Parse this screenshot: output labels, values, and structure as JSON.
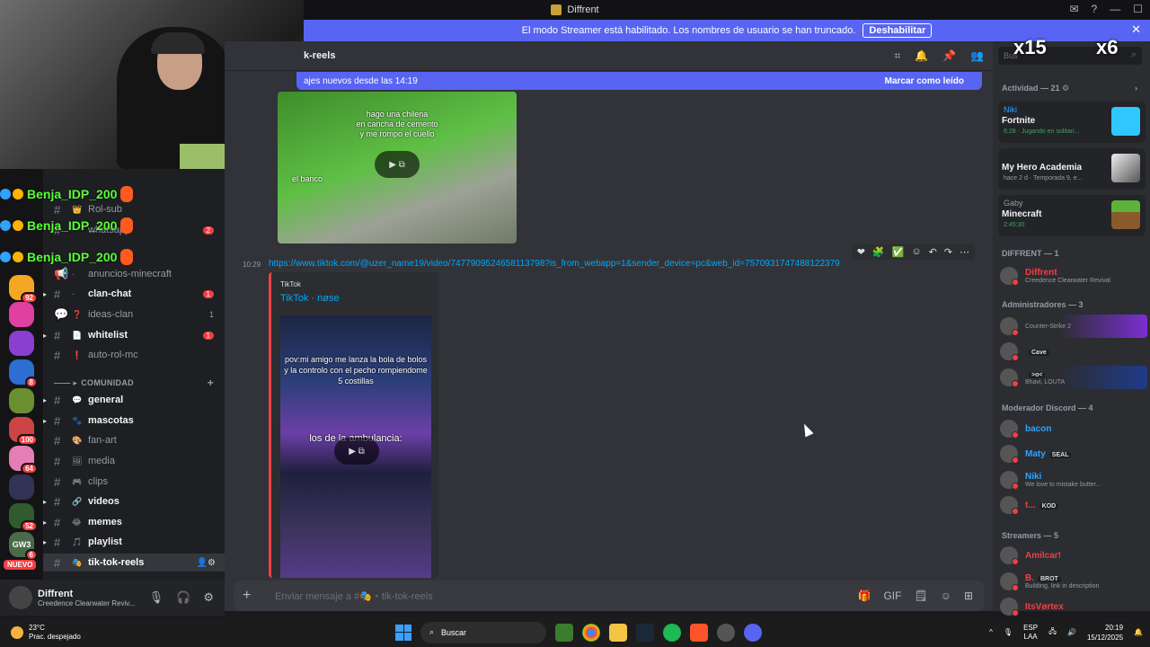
{
  "titlebar": {
    "title": "Diffrent"
  },
  "streamer_bar": {
    "text": "El modo Streamer está habilitado. Los nombres de usuario se han truncado.",
    "button": "Deshabilitar"
  },
  "overlay": {
    "users": [
      "Benja_IDP_200",
      "Benja_IDP_200",
      "Benja_IDP_200"
    ],
    "emotes": [
      "x15",
      "x6"
    ]
  },
  "guilds": [
    {
      "badge": "92"
    },
    {
      "badge": ""
    },
    {
      "badge": ""
    },
    {
      "badge": "8"
    },
    {
      "badge": ""
    },
    {
      "badge": "100"
    },
    {
      "badge": "64"
    },
    {
      "badge": ""
    },
    {
      "badge": "52"
    },
    {
      "badge": "6"
    },
    {
      "label": "NUEVO"
    }
  ],
  "channels": {
    "top": [
      {
        "label": "Rol-sub",
        "badge": ""
      },
      {
        "label": "whatsapp",
        "badge": "2"
      },
      {
        "label": "anuncios-minecraft",
        "badge": ""
      }
    ],
    "list": [
      {
        "label": "clan-chat",
        "badge": "1",
        "bold": true
      },
      {
        "label": "ideas-clan",
        "count": "1",
        "bold": false
      },
      {
        "label": "whitelist",
        "badge": "1",
        "bold": true
      },
      {
        "label": "auto-rol-mc",
        "badge": "",
        "bold": false
      }
    ],
    "category": "COMUNIDAD",
    "community": [
      {
        "label": "general",
        "bold": true
      },
      {
        "label": "mascotas",
        "bold": true
      },
      {
        "label": "fan-art",
        "bold": false
      },
      {
        "label": "media",
        "bold": false
      },
      {
        "label": "clips",
        "bold": false
      },
      {
        "label": "videos",
        "bold": true
      },
      {
        "label": "memes",
        "bold": true
      },
      {
        "label": "playlist",
        "bold": true
      },
      {
        "label": "tik-tok-reels",
        "bold": true,
        "selected": true
      }
    ]
  },
  "user_panel": {
    "name": "Diffrent",
    "status": "Creedence Clearwater Reviv..."
  },
  "header": {
    "channel": "k-reels"
  },
  "new_messages": {
    "text": "ajes nuevos desde las 14:19",
    "action": "Marcar como leído"
  },
  "message1": {
    "captions": [
      "hago una chilena",
      "en cancha de cemento",
      "y me rompo el cuello",
      "el banco"
    ]
  },
  "message2": {
    "time": "10:29",
    "link": "https://www.tiktok.com/@uzer_name19/video/7477909524658113798?is_from_webapp=1&sender_device=pc&web_id=7570931747488122379",
    "embed_provider": "TikTok",
    "embed_title": "TikTok · nøse",
    "captions": [
      "pov:mi amigo me lanza la bola de bolos",
      "y la controlo con el pecho rompiendome",
      "5 costillas",
      "los de la ambulancia:"
    ]
  },
  "composer": {
    "placeholder": "Enviar mensaje a #🎭・tik-tok-reels"
  },
  "members": {
    "search": "Bus",
    "activity_title": "Actividad — 21",
    "activities": [
      {
        "who": "Niki",
        "game": "Fortnite",
        "detail": "6:28 · Jugando en solitari..."
      },
      {
        "who": "",
        "game": "My Hero Academia",
        "detail": "hace 2 d · Temporada 9, e..."
      },
      {
        "who": "Gaby",
        "game": "Minecraft",
        "detail": "2:45:30"
      }
    ],
    "groups": [
      {
        "title": "DIFFRENT — 1",
        "members": [
          {
            "name": "Diffrent",
            "status": "Creedence Clearwater Revival",
            "color": "#f23f43"
          }
        ]
      },
      {
        "title": "Administradores — 3",
        "members": [
          {
            "name": "",
            "status": "Counter-Strike 2",
            "color": "#5865f2"
          },
          {
            "name": "",
            "status": "",
            "tag": "Cave",
            "color": "#5865f2"
          },
          {
            "name": "",
            "status": "Bhavi, LOUTA",
            "tag": ">o<",
            "color": "#5865f2"
          }
        ]
      },
      {
        "title": "Moderador Discord — 4",
        "members": [
          {
            "name": "bacon",
            "status": "",
            "color": "#2ea3ff"
          },
          {
            "name": "Maty",
            "status": "",
            "tag": "SEAL",
            "color": "#2ea3ff"
          },
          {
            "name": "Niki",
            "status": "We love to mistake butter...",
            "color": "#2ea3ff"
          },
          {
            "name": "t...",
            "status": "",
            "tag": "KOD",
            "color": "#f23f43"
          }
        ]
      },
      {
        "title": "Streamers — 5",
        "members": [
          {
            "name": "Amilcar!",
            "status": "",
            "color": "#f23f43"
          },
          {
            "name": "B.",
            "status": "Building, link in description",
            "tag": "BROT",
            "color": "#f23f43"
          },
          {
            "name": "ItsVørtex",
            "status": "",
            "color": "#f23f43"
          }
        ]
      }
    ]
  },
  "taskbar": {
    "weather_temp": "23°C",
    "weather_desc": "Prac. despejado",
    "search": "Buscar",
    "lang1": "ESP",
    "lang2": "LAA",
    "time": "20:19",
    "date": "15/12/2025"
  }
}
